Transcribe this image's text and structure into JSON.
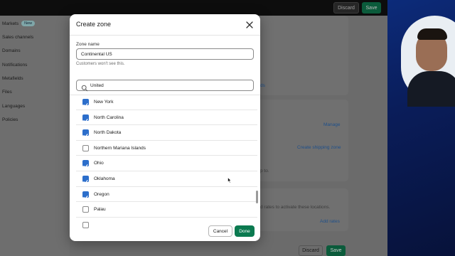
{
  "app": {
    "topbar": {
      "discard": "Discard",
      "save": "Save"
    },
    "sidebar": [
      {
        "label": "Markets",
        "badge": "New"
      },
      {
        "label": "Sales channels"
      },
      {
        "label": "Domains"
      },
      {
        "label": "Notifications"
      },
      {
        "label": "Metafields"
      },
      {
        "label": "Files"
      },
      {
        "label": "Languages"
      },
      {
        "label": "Policies"
      }
    ],
    "background": {
      "link_fragment": "ds",
      "manage": "Manage",
      "create_shipping_zone": "Create shipping zone",
      "text_fragment_1": "p to.",
      "text_fragment_2": "d rates to activate these locations.",
      "add_rates": "Add rates"
    },
    "bottombar": {
      "discard": "Discard",
      "save": "Save"
    }
  },
  "modal": {
    "title": "Create zone",
    "zone_name_label": "Zone name",
    "zone_name_value": "Continental US",
    "zone_name_help": "Customers won't see this.",
    "search_value": "United",
    "regions": [
      {
        "label": "New York",
        "checked": true
      },
      {
        "label": "North Carolina",
        "checked": true
      },
      {
        "label": "North Dakota",
        "checked": true
      },
      {
        "label": "Northern Mariana Islands",
        "checked": false
      },
      {
        "label": "Ohio",
        "checked": true
      },
      {
        "label": "Oklahoma",
        "checked": true
      },
      {
        "label": "Oregon",
        "checked": true
      },
      {
        "label": "Palau",
        "checked": false
      },
      {
        "label": "",
        "checked": false
      }
    ],
    "cancel": "Cancel",
    "done": "Done"
  },
  "colors": {
    "accent": "#2c6ecb",
    "primary_button": "#0b7a50"
  }
}
